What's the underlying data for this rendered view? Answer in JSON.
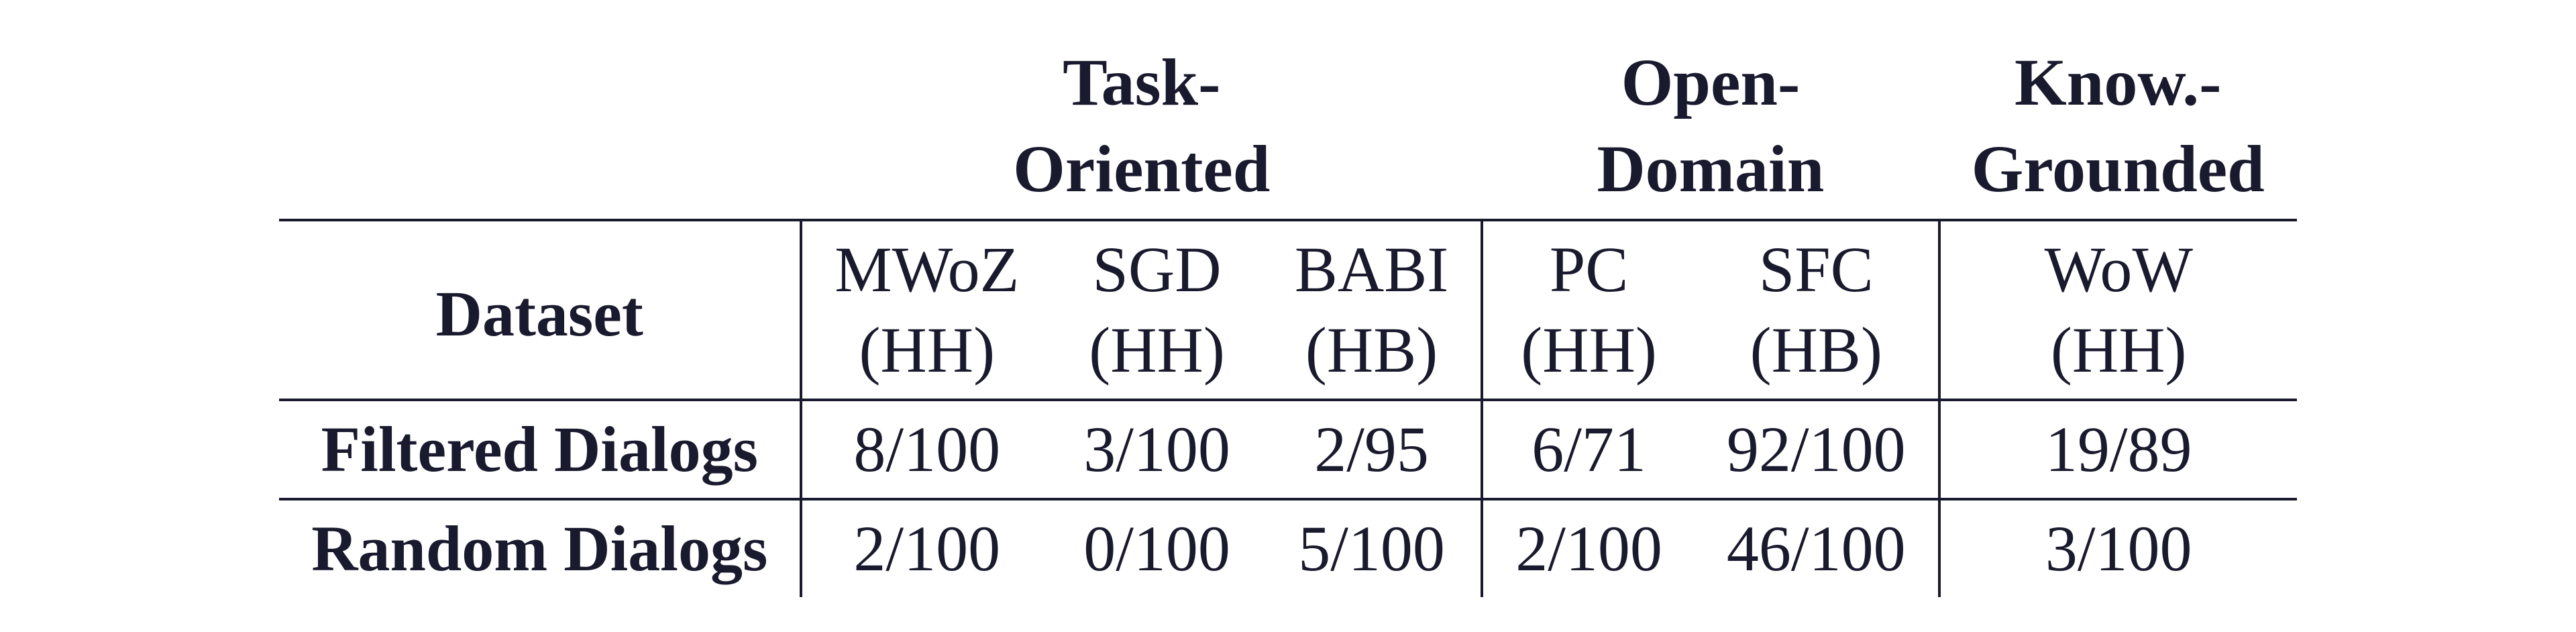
{
  "chart_data": {
    "type": "table",
    "title": "",
    "column_groups": [
      {
        "label": "Task-\nOriented",
        "columns": [
          "MWoZ (HH)",
          "SGD (HH)",
          "BABI (HB)"
        ]
      },
      {
        "label": "Open-\nDomain",
        "columns": [
          "PC (HH)",
          "SFC (HB)"
        ]
      },
      {
        "label": "Know.-\nGrounded",
        "columns": [
          "WoW (HH)"
        ]
      }
    ],
    "rows": [
      {
        "label": "Filtered Dialogs",
        "values": [
          "8/100",
          "3/100",
          "2/95",
          "6/71",
          "92/100",
          "19/89"
        ]
      },
      {
        "label": "Random Dialogs",
        "values": [
          "2/100",
          "0/100",
          "5/100",
          "2/100",
          "46/100",
          "3/100"
        ]
      }
    ]
  },
  "table": {
    "header_groups": {
      "task_oriented_l1": "Task-",
      "task_oriented_l2": "Oriented",
      "open_domain_l1": "Open-",
      "open_domain_l2": "Domain",
      "know_grounded_l1": "Know.-",
      "know_grounded_l2": "Grounded"
    },
    "dataset_label": "Dataset",
    "columns": {
      "mwoz_l1": "MWoZ",
      "mwoz_l2": "(HH)",
      "sgd_l1": "SGD",
      "sgd_l2": "(HH)",
      "babi_l1": "BABI",
      "babi_l2": "(HB)",
      "pc_l1": "PC",
      "pc_l2": "(HH)",
      "sfc_l1": "SFC",
      "sfc_l2": "(HB)",
      "wow_l1": "WoW",
      "wow_l2": "(HH)"
    },
    "rows": {
      "filtered_label": "Filtered Dialogs",
      "filtered": {
        "mwoz": "8/100",
        "sgd": "3/100",
        "babi": "2/95",
        "pc": "6/71",
        "sfc": "92/100",
        "wow": "19/89"
      },
      "random_label": "Random Dialogs",
      "random": {
        "mwoz": "2/100",
        "sgd": "0/100",
        "babi": "5/100",
        "pc": "2/100",
        "sfc": "46/100",
        "wow": "3/100"
      }
    }
  }
}
